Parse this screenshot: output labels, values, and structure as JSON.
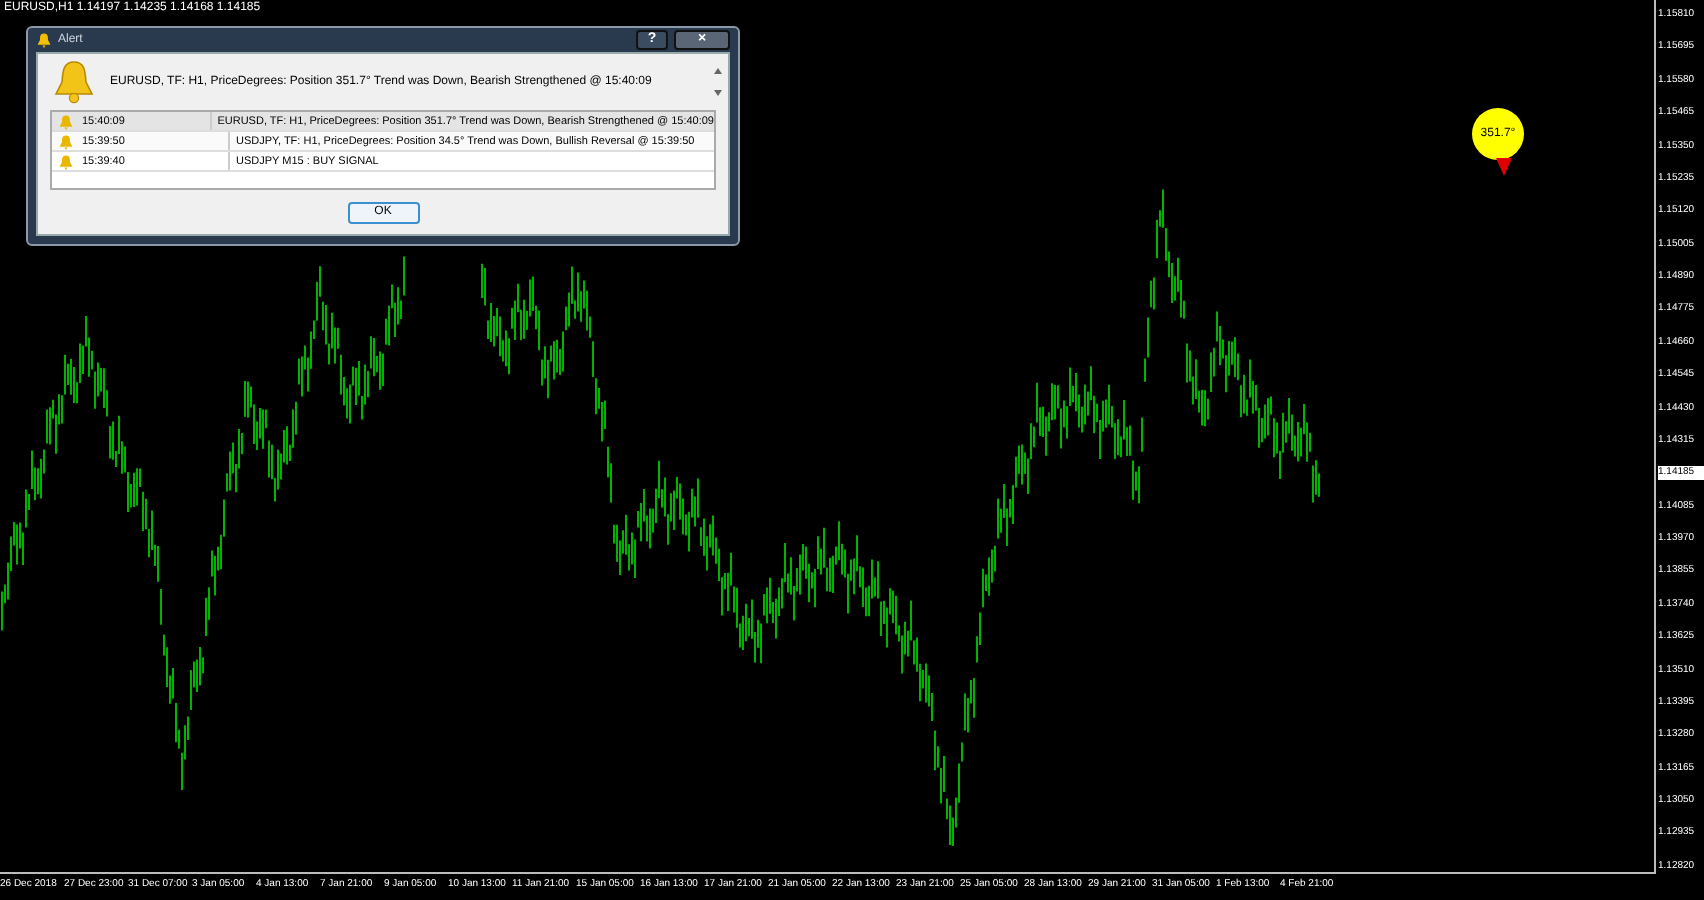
{
  "chart_header": "EURUSD,H1  1.14197 1.14235 1.14168 1.14185",
  "price_axis": [
    {
      "label": "1.15810",
      "current": false
    },
    {
      "label": "1.15695",
      "current": false
    },
    {
      "label": "1.15580",
      "current": false
    },
    {
      "label": "1.15465",
      "current": false
    },
    {
      "label": "1.15350",
      "current": false
    },
    {
      "label": "1.15235",
      "current": false
    },
    {
      "label": "1.15120",
      "current": false
    },
    {
      "label": "1.15005",
      "current": false
    },
    {
      "label": "1.14890",
      "current": false
    },
    {
      "label": "1.14775",
      "current": false
    },
    {
      "label": "1.14660",
      "current": false
    },
    {
      "label": "1.14545",
      "current": false
    },
    {
      "label": "1.14430",
      "current": false
    },
    {
      "label": "1.14315",
      "current": false
    },
    {
      "label": "1.14185",
      "current": true
    },
    {
      "label": "1.14085",
      "current": false
    },
    {
      "label": "1.13970",
      "current": false
    },
    {
      "label": "1.13855",
      "current": false
    },
    {
      "label": "1.13740",
      "current": false
    },
    {
      "label": "1.13625",
      "current": false
    },
    {
      "label": "1.13510",
      "current": false
    },
    {
      "label": "1.13395",
      "current": false
    },
    {
      "label": "1.13280",
      "current": false
    },
    {
      "label": "1.13165",
      "current": false
    },
    {
      "label": "1.13050",
      "current": false
    },
    {
      "label": "1.12935",
      "current": false
    },
    {
      "label": "1.12820",
      "current": false
    }
  ],
  "time_axis": [
    "26 Dec 2018",
    "27 Dec 23:00",
    "31 Dec 07:00",
    "3 Jan 05:00",
    "4 Jan 13:00",
    "7 Jan 21:00",
    "9 Jan 05:00",
    "10 Jan 13:00",
    "11 Jan 21:00",
    "15 Jan 05:00",
    "16 Jan 13:00",
    "17 Jan 21:00",
    "21 Jan 05:00",
    "22 Jan 13:00",
    "23 Jan 21:00",
    "25 Jan 05:00",
    "28 Jan 13:00",
    "29 Jan 21:00",
    "31 Jan 05:00",
    "1 Feb 13:00",
    "4 Feb 21:00"
  ],
  "angle_marker": "351.7°",
  "alert": {
    "title": "Alert",
    "message": "EURUSD, TF: H1, PriceDegrees: Position 351.7° Trend was Down, Bearish Strengthened @ 15:40:09",
    "rows": [
      {
        "time": "15:40:09",
        "text": "EURUSD, TF: H1, PriceDegrees: Position 351.7° Trend was Down, Bearish Strengthened @ 15:40:09",
        "selected": true
      },
      {
        "time": "15:39:50",
        "text": "USDJPY, TF: H1, PriceDegrees: Position 34.5° Trend was Down, Bullish Reversal @ 15:39:50",
        "selected": false
      },
      {
        "time": "15:39:40",
        "text": "USDJPY M15 :  BUY SIGNAL",
        "selected": false
      }
    ],
    "help_button": "?",
    "close_button": "×",
    "ok_button": "OK"
  }
}
